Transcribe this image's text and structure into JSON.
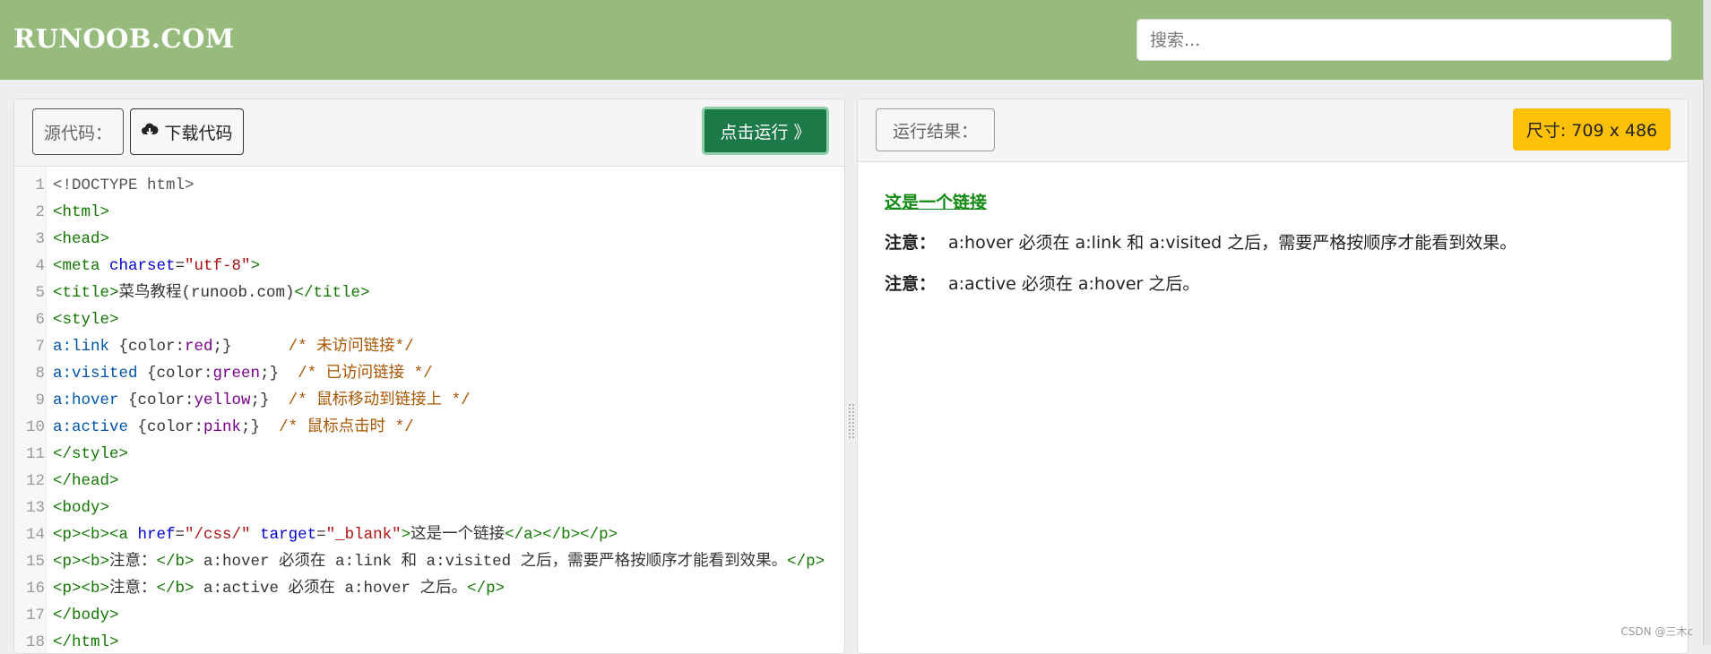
{
  "header": {
    "logo": "RUNOOB.COM",
    "search_placeholder": "搜索..."
  },
  "editor": {
    "source_label": "源代码：",
    "download_label": "下载代码",
    "run_label": "点击运行 》",
    "lines": [
      {
        "n": "1",
        "parts": [
          [
            "doc",
            "<!DOCTYPE html>"
          ]
        ]
      },
      {
        "n": "2",
        "parts": [
          [
            "tag",
            "<html>"
          ]
        ]
      },
      {
        "n": "3",
        "parts": [
          [
            "tag",
            "<head>"
          ]
        ]
      },
      {
        "n": "4",
        "parts": [
          [
            "tag",
            "<meta "
          ],
          [
            "attr",
            "charset"
          ],
          [
            "txt",
            "="
          ],
          [
            "str",
            "\"utf-8\""
          ],
          [
            "tag",
            ">"
          ]
        ]
      },
      {
        "n": "5",
        "parts": [
          [
            "tag",
            "<title>"
          ],
          [
            "txt",
            "菜鸟教程(runoob.com)"
          ],
          [
            "tag",
            "</title>"
          ]
        ]
      },
      {
        "n": "6",
        "parts": [
          [
            "tag",
            "<style>"
          ]
        ]
      },
      {
        "n": "7",
        "parts": [
          [
            "sel",
            "a:link "
          ],
          [
            "prop",
            "{color:"
          ],
          [
            "val",
            "red"
          ],
          [
            "prop",
            ";}      "
          ],
          [
            "com",
            "/* 未访问链接*/"
          ]
        ]
      },
      {
        "n": "8",
        "parts": [
          [
            "sel",
            "a:visited "
          ],
          [
            "prop",
            "{color:"
          ],
          [
            "val",
            "green"
          ],
          [
            "prop",
            ";}  "
          ],
          [
            "com",
            "/* 已访问链接 */"
          ]
        ]
      },
      {
        "n": "9",
        "parts": [
          [
            "sel",
            "a:hover "
          ],
          [
            "prop",
            "{color:"
          ],
          [
            "val",
            "yellow"
          ],
          [
            "prop",
            ";}  "
          ],
          [
            "com",
            "/* 鼠标移动到链接上 */"
          ]
        ]
      },
      {
        "n": "10",
        "parts": [
          [
            "sel",
            "a:active "
          ],
          [
            "prop",
            "{color:"
          ],
          [
            "val",
            "pink"
          ],
          [
            "prop",
            ";}  "
          ],
          [
            "com",
            "/* 鼠标点击时 */"
          ]
        ]
      },
      {
        "n": "11",
        "parts": [
          [
            "tag",
            "</style>"
          ]
        ]
      },
      {
        "n": "12",
        "parts": [
          [
            "tag",
            "</head>"
          ]
        ]
      },
      {
        "n": "13",
        "parts": [
          [
            "tag",
            "<body>"
          ]
        ]
      },
      {
        "n": "14",
        "parts": [
          [
            "tag",
            "<p><b><a "
          ],
          [
            "attr",
            "href"
          ],
          [
            "txt",
            "="
          ],
          [
            "str",
            "\"/css/\""
          ],
          [
            "attr",
            " target"
          ],
          [
            "txt",
            "="
          ],
          [
            "str",
            "\"_blank\""
          ],
          [
            "tag",
            ">"
          ],
          [
            "txt",
            "这是一个链接"
          ],
          [
            "tag",
            "</a></b></p>"
          ]
        ]
      },
      {
        "n": "15",
        "parts": [
          [
            "tag",
            "<p><b>"
          ],
          [
            "txt",
            "注意："
          ],
          [
            "tag",
            "</b>"
          ],
          [
            "txt",
            " a:hover 必须在 a:link 和 a:visited 之后，需要严格按顺序才能看到效果。"
          ],
          [
            "tag",
            "</p>"
          ]
        ]
      },
      {
        "n": "16",
        "parts": [
          [
            "tag",
            "<p><b>"
          ],
          [
            "txt",
            "注意："
          ],
          [
            "tag",
            "</b>"
          ],
          [
            "txt",
            " a:active 必须在 a:hover 之后。"
          ],
          [
            "tag",
            "</p>"
          ]
        ]
      },
      {
        "n": "17",
        "parts": [
          [
            "tag",
            "</body>"
          ]
        ]
      },
      {
        "n": "18",
        "parts": [
          [
            "tag",
            "</html>"
          ]
        ]
      }
    ]
  },
  "result": {
    "label": "运行结果：",
    "size_badge": "尺寸: 709 x 486",
    "link_text": "这是一个链接",
    "note1_bold": "注意：",
    "note1_text": "a:hover 必须在 a:link 和 a:visited 之后，需要严格按顺序才能看到效果。",
    "note2_bold": "注意：",
    "note2_text": "a:active 必须在 a:hover 之后。"
  },
  "watermark": "CSDN @三木c",
  "colors": {
    "header_bg": "#96bb7c",
    "run_button": "#1b7a47",
    "size_badge": "#ffc107",
    "link_color": "#118811"
  }
}
